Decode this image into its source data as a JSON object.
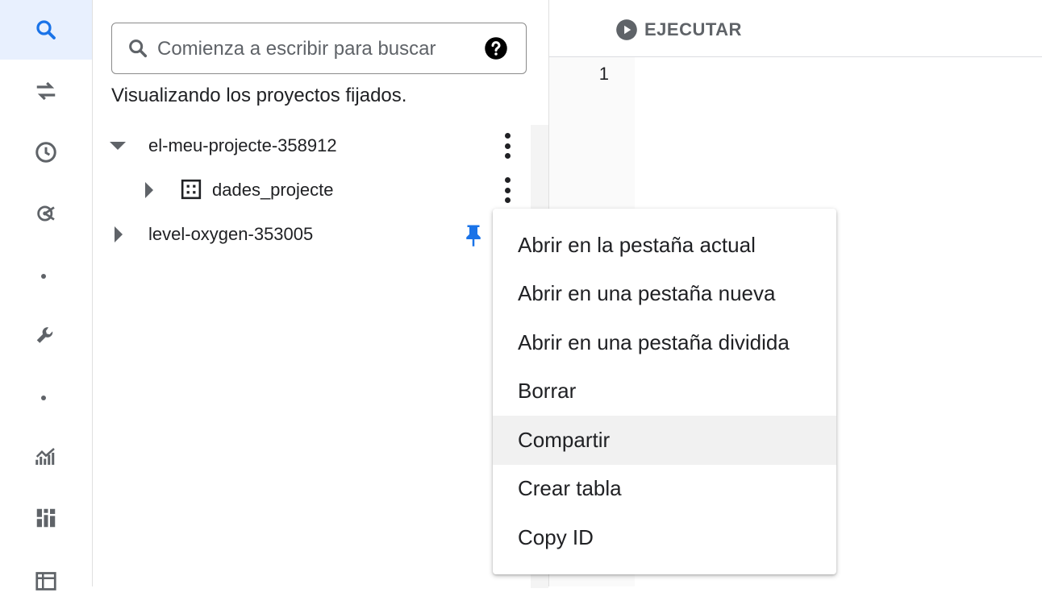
{
  "search": {
    "placeholder": "Comienza a escribir para buscar"
  },
  "explorer": {
    "pinned_message": "Visualizando los proyectos fijados.",
    "tree": [
      {
        "label": "el-meu-projecte-358912",
        "expanded": true
      },
      {
        "label": "dades_projecte",
        "type": "dataset"
      },
      {
        "label": "level-oxygen-353005",
        "pinned": true
      }
    ]
  },
  "editor": {
    "run_label": "EJECUTAR",
    "line_numbers": [
      "1"
    ]
  },
  "context_menu": {
    "items": [
      "Abrir en la pestaña actual",
      "Abrir en una pestaña nueva",
      "Abrir en una pestaña dividida",
      "Borrar",
      "Compartir",
      "Crear tabla",
      "Copy ID"
    ],
    "highlighted": "Compartir"
  },
  "colors": {
    "accent": "#1a73e8",
    "pin": "#1a73e8",
    "icon_gray": "#5f6368",
    "active_rail_bg": "#e8f0fe"
  },
  "rail_icons": [
    "search-icon",
    "transfer-icon",
    "history-icon",
    "analytics-hub-icon",
    "wrench-icon",
    "chart-icon",
    "dashboard-icon",
    "table-icon"
  ]
}
